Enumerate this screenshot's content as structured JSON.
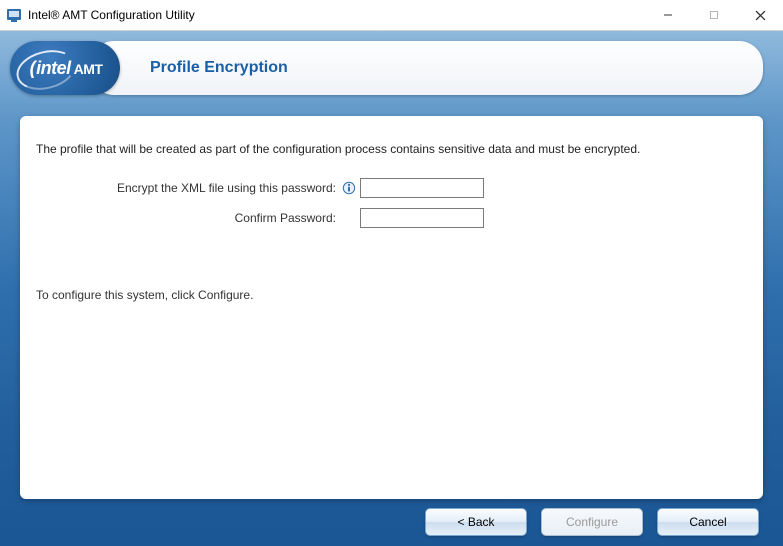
{
  "window": {
    "title": "Intel® AMT Configuration Utility"
  },
  "header": {
    "logo_main": "intel",
    "logo_suffix": "AMT",
    "page_title": "Profile Encryption"
  },
  "body": {
    "intro": "The profile that will be created as part of the configuration process contains sensitive data and must be encrypted.",
    "password_label": "Encrypt the XML file using this password:",
    "confirm_label": "Confirm Password:",
    "password_value": "",
    "confirm_value": "",
    "hint": "To configure this system, click Configure."
  },
  "footer": {
    "back": "< Back",
    "configure": "Configure",
    "cancel": "Cancel"
  },
  "icons": {
    "app": "intel-amt-app-icon",
    "info": "info-icon"
  }
}
